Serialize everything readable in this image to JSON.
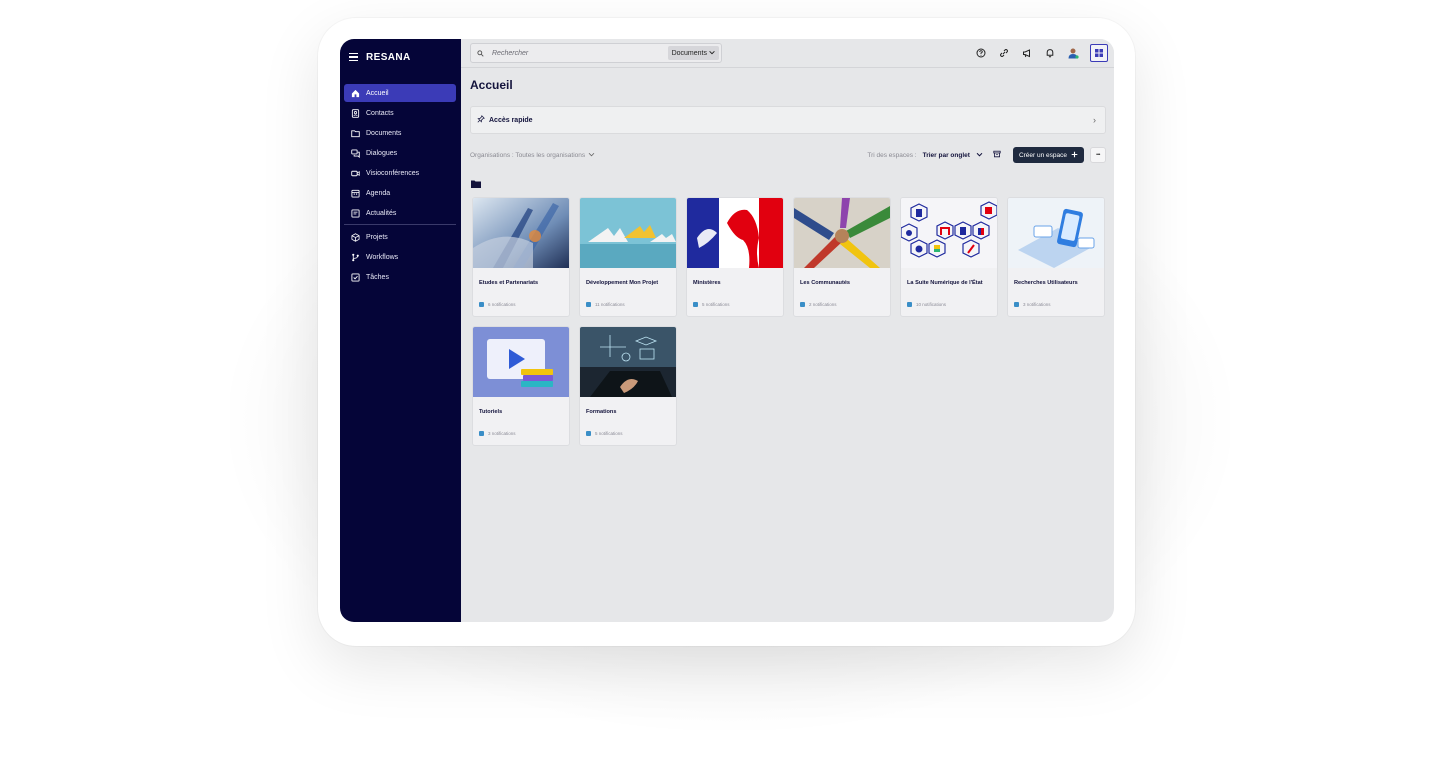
{
  "app": {
    "brand": "RESANA"
  },
  "sidebar": {
    "items": [
      {
        "label": "Accueil",
        "icon": "home-icon",
        "active": true
      },
      {
        "label": "Contacts",
        "icon": "contacts-icon"
      },
      {
        "label": "Documents",
        "icon": "folder-icon"
      },
      {
        "label": "Dialogues",
        "icon": "chat-icon"
      },
      {
        "label": "Visioconférences",
        "icon": "video-icon"
      },
      {
        "label": "Agenda",
        "icon": "calendar-icon"
      },
      {
        "label": "Actualités",
        "icon": "news-icon"
      }
    ],
    "items2": [
      {
        "label": "Projets",
        "icon": "cube-icon"
      },
      {
        "label": "Workflows",
        "icon": "workflow-icon"
      },
      {
        "label": "Tâches",
        "icon": "checkbox-icon"
      }
    ]
  },
  "topbar": {
    "search_placeholder": "Rechercher",
    "search_scope": "Documents"
  },
  "page": {
    "title": "Accueil",
    "quick_access": "Accès rapide",
    "org_filter": "Organisations : Toutes les organisations",
    "sort_label": "Tri des espaces :",
    "sort_value": "Trier par onglet",
    "create_button": "Créer un espace",
    "more_button": "•••"
  },
  "spaces": [
    {
      "title": "Etudes et Partenariats",
      "notif": "6 notifications"
    },
    {
      "title": "Développement Mon Projet",
      "notif": "11 notifications"
    },
    {
      "title": "Ministères",
      "notif": "5 notifications"
    },
    {
      "title": "Les Communautés",
      "notif": "2 notifications"
    },
    {
      "title": "La Suite Numérique de l'État",
      "notif": "10 notifications"
    },
    {
      "title": "Recherches Utilisateurs",
      "notif": "3 notifications"
    },
    {
      "title": "Tutoriels",
      "notif": "3 notifications"
    },
    {
      "title": "Formations",
      "notif": "5 notifications"
    }
  ],
  "colors": {
    "sidebar": "#050538",
    "active": "#3b3bb7",
    "accent": "#3a8ec7"
  }
}
